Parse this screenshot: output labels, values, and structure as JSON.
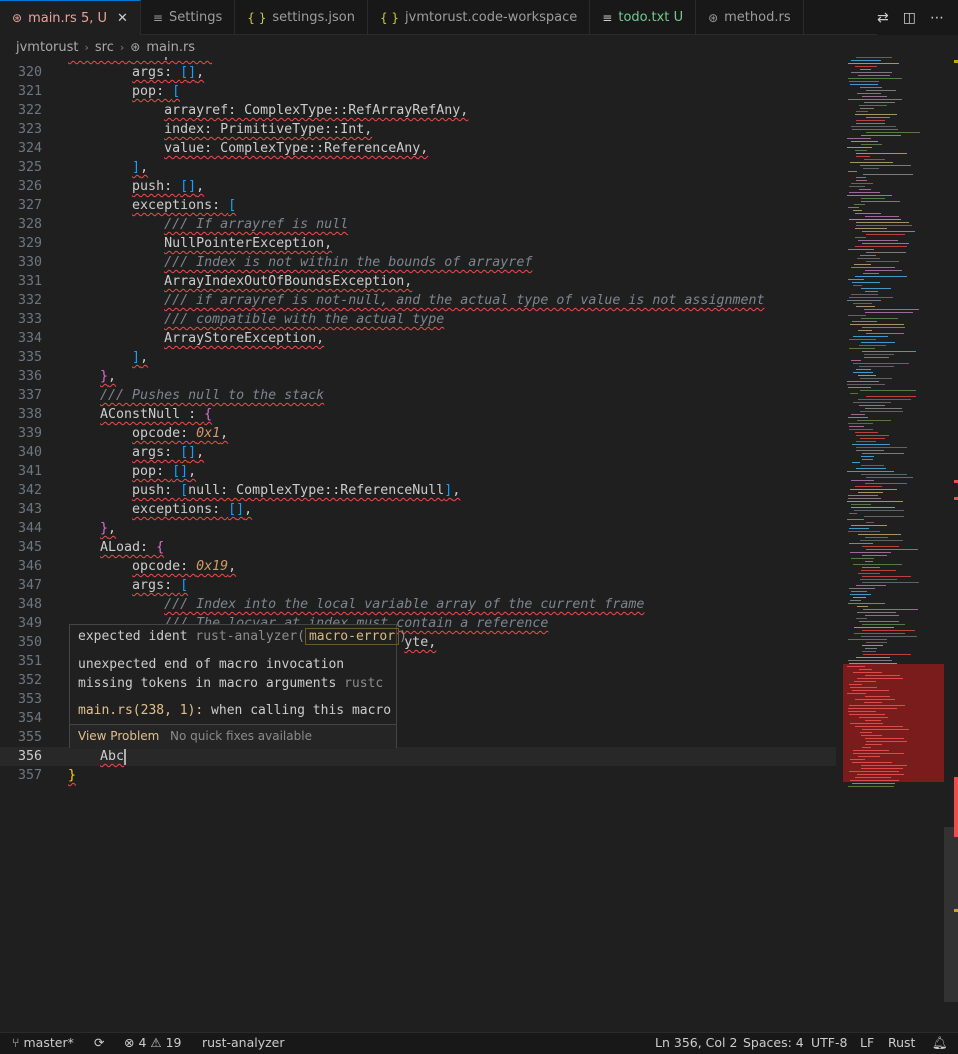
{
  "tabs": [
    {
      "icon": "⊛",
      "label": "main.rs",
      "badge": "5, U",
      "active": true,
      "close": "✕"
    },
    {
      "icon": "≡",
      "label": "Settings"
    },
    {
      "icon": "{ }",
      "label": "settings.json"
    },
    {
      "icon": "{ }",
      "label": "jvmtorust.code-workspace"
    },
    {
      "icon": "≡",
      "label": "todo.txt",
      "badge": "U"
    },
    {
      "icon": "⊛",
      "label": "method.rs"
    }
  ],
  "breadcrumb": [
    "jvmtorust",
    "src",
    "main.rs"
  ],
  "editor": {
    "lines": [
      {
        "n": "320",
        "text": "        args: [],"
      },
      {
        "n": "321",
        "text": "        pop: ["
      },
      {
        "n": "322",
        "text": "            arrayref: ComplexType::RefArrayRefAny,"
      },
      {
        "n": "323",
        "text": "            index: PrimitiveType::Int,"
      },
      {
        "n": "324",
        "text": "            value: ComplexType::ReferenceAny,"
      },
      {
        "n": "325",
        "text": "        ],"
      },
      {
        "n": "326",
        "text": "        push: [],"
      },
      {
        "n": "327",
        "text": "        exceptions: ["
      },
      {
        "n": "328",
        "text": "            /// If arrayref is null"
      },
      {
        "n": "329",
        "text": "            NullPointerException,"
      },
      {
        "n": "330",
        "text": "            /// Index is not within the bounds of arrayref"
      },
      {
        "n": "331",
        "text": "            ArrayIndexOutOfBoundsException,"
      },
      {
        "n": "332",
        "text": "            /// if arrayref is not-null, and the actual type of value is not assignment"
      },
      {
        "n": "333",
        "text": "            /// compatible with the actual type"
      },
      {
        "n": "334",
        "text": "            ArrayStoreException,"
      },
      {
        "n": "335",
        "text": "        ],"
      },
      {
        "n": "336",
        "text": "    },"
      },
      {
        "n": "337",
        "text": "    /// Pushes null to the stack"
      },
      {
        "n": "338",
        "text": "    AConstNull : {"
      },
      {
        "n": "339",
        "text": "        opcode: 0x1,"
      },
      {
        "n": "340",
        "text": "        args: [],"
      },
      {
        "n": "341",
        "text": "        pop: [],"
      },
      {
        "n": "342",
        "text": "        push: [null: ComplexType::ReferenceNull],"
      },
      {
        "n": "343",
        "text": "        exceptions: [],"
      },
      {
        "n": "344",
        "text": "    },"
      },
      {
        "n": "345",
        "text": "    ALoad: {"
      },
      {
        "n": "346",
        "text": "        opcode: 0x19,"
      },
      {
        "n": "347",
        "text": "        args: ["
      },
      {
        "n": "348",
        "text": "            /// Index into the local variable array of the current frame"
      },
      {
        "n": "349",
        "text": "            /// The locvar at index must contain a reference"
      },
      {
        "n": "350",
        "text": "                                          yte,"
      },
      {
        "n": "351",
        "text": ""
      },
      {
        "n": "352",
        "text": ""
      },
      {
        "n": "353",
        "text": ""
      },
      {
        "n": "354",
        "text": ""
      },
      {
        "n": "355",
        "text": ""
      },
      {
        "n": "356",
        "text": "    Abc"
      },
      {
        "n": "357",
        "text": "}"
      }
    ]
  },
  "hover": {
    "line1_main": "expected ident ",
    "line1_source": "rust-analyzer",
    "line1_open": "(",
    "line1_code": "macro-error",
    "line1_close": ")",
    "line2": "unexpected end of macro invocation",
    "line3_main": "missing tokens in macro arguments ",
    "line3_source": "rustc",
    "line4_link": "main.rs(238, 1):",
    "line4_rest": " when calling this macro",
    "view_problem": "View Problem",
    "no_fixes": "No quick fixes available"
  },
  "statusbar": {
    "branch": "master*",
    "errors": "4",
    "warnings": "19",
    "language_server": "rust-analyzer",
    "position": "Ln 356, Col 2",
    "spaces": "Spaces: 4",
    "encoding": "UTF-8",
    "eol": "LF",
    "language": "Rust"
  },
  "icons": {
    "rust_file": "rust-file-icon",
    "settings_file": "settings-file-icon",
    "json_file": "json-file-icon",
    "text_file": "text-file-icon",
    "branch": "git-branch-icon",
    "sync": "sync-icon",
    "error": "error-icon",
    "warning": "warning-icon",
    "bell": "bell-icon"
  },
  "colors": {
    "error": "#f14c4c",
    "accent": "#0078d4",
    "modified_tab": "#e8a39f",
    "untracked": "#73c991",
    "link": "#e2c08d"
  }
}
